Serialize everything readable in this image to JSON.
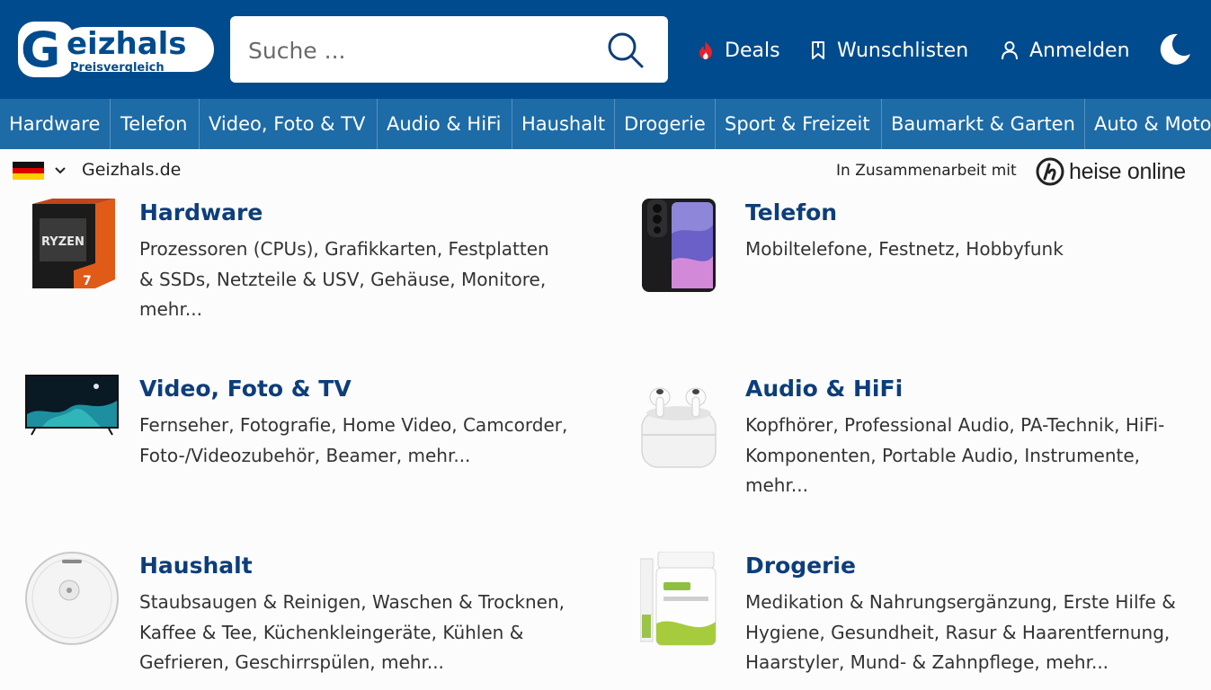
{
  "header": {
    "logo_text": "Geizhals",
    "logo_subtext": "Preisvergleich",
    "search_placeholder": "Suche ...",
    "links": [
      {
        "label": "Deals",
        "icon": "flame-icon"
      },
      {
        "label": "Wunschlisten",
        "icon": "bookmark-icon"
      },
      {
        "label": "Anmelden",
        "icon": "user-icon"
      }
    ],
    "theme_icon": "moon-icon",
    "colors": {
      "header_bg": "#004b8d",
      "nav_bg": "#1d6ba7",
      "deal_flame": "#e4232f",
      "title": "#0d3e7a"
    }
  },
  "nav": {
    "items": [
      "Hardware",
      "Telefon",
      "Video, Foto & TV",
      "Audio & HiFi",
      "Haushalt",
      "Drogerie",
      "Sport & Freizeit",
      "Baumarkt & Garten",
      "Auto & Motorrad"
    ]
  },
  "country": {
    "site": "Geizhals.de",
    "partner_text": "In Zusammenarbeit mit",
    "partner_logo": "heise online"
  },
  "categories": [
    {
      "title": "Hardware",
      "desc_lines": [
        "Prozessoren (CPUs), Grafikkarten, Festplatten",
        "& SSDs, Netzteile & USV, Gehäuse, Monitore,",
        "mehr..."
      ],
      "image": "cpu-box-image"
    },
    {
      "title": "Telefon",
      "desc_lines": [
        "Mobiltelefone, Festnetz, Hobbyfunk"
      ],
      "image": "smartphone-image"
    },
    {
      "title": "Video, Foto & TV",
      "desc_lines": [
        "Fernseher, Fotografie, Home Video, Camcorder,",
        "Foto-/Videozubehör, Beamer, mehr..."
      ],
      "image": "tv-image"
    },
    {
      "title": "Audio & HiFi",
      "desc_lines": [
        "Kopfhörer, Professional Audio, PA-Technik, HiFi-",
        "Komponenten, Portable Audio, Instrumente,",
        "mehr..."
      ],
      "image": "earbuds-image"
    },
    {
      "title": "Haushalt",
      "desc_lines": [
        "Staubsaugen & Reinigen, Waschen & Trocknen,",
        "Kaffee & Tee, Küchenkleingeräte, Kühlen &",
        "Gefrieren, Geschirrspülen, mehr..."
      ],
      "image": "robot-vacuum-image"
    },
    {
      "title": "Drogerie",
      "desc_lines": [
        "Medikation & Nahrungsergänzung, Erste Hilfe &",
        "Hygiene, Gesundheit, Rasur & Haarentfernung,",
        "Haarstyler, Mund- & Zahnpflege, mehr..."
      ],
      "image": "supplement-jar-image"
    }
  ]
}
